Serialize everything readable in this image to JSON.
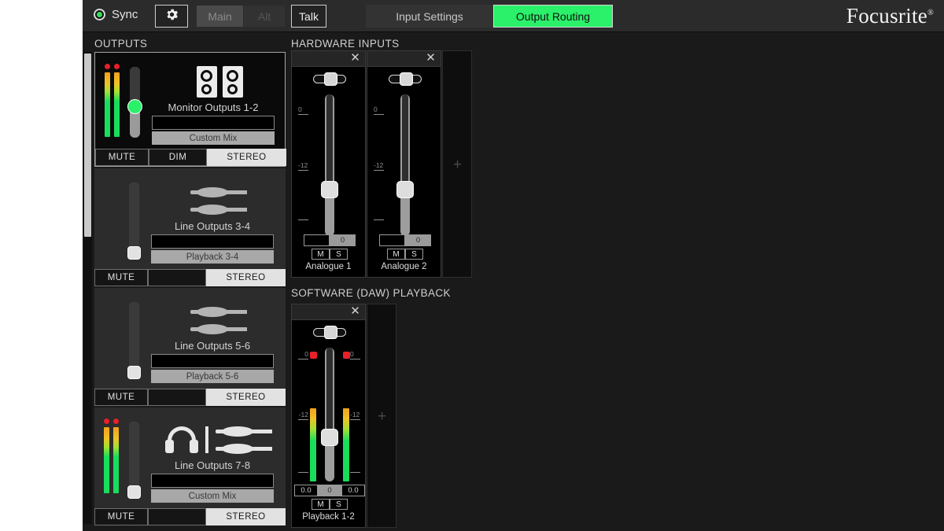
{
  "header": {
    "sync_label": "Sync",
    "gear_icon": "gear-icon",
    "main_label": "Main",
    "alt_label": "Alt",
    "talk_label": "Talk",
    "tab_input": "Input Settings",
    "tab_output": "Output Routing",
    "brand": "Focusrite",
    "brand_mark": "®",
    "active_tab": "Output Routing",
    "accent_color": "#2bf06a"
  },
  "sections": {
    "outputs": "OUTPUTS",
    "hardware_inputs": "HARDWARE INPUTS",
    "software_playback": "SOFTWARE (DAW) PLAYBACK"
  },
  "outputs": [
    {
      "name": "Monitor Outputs 1-2",
      "icon": "speakers-icon",
      "source_field": "",
      "source": "Custom Mix",
      "selected": true,
      "fader_pos": 0.45,
      "knob_style": "green",
      "meters": [
        {
          "level": 0.78,
          "clip": true
        },
        {
          "level": 0.78,
          "clip": true
        }
      ],
      "buttons": [
        "MUTE",
        "DIM",
        "STEREO"
      ],
      "active_button": "STEREO"
    },
    {
      "name": "Line Outputs 3-4",
      "icon": "trs-jacks-icon",
      "source_field": "",
      "source": "Playback 3-4",
      "selected": false,
      "fader_pos": 0.04,
      "knob_style": "plain",
      "meters": [],
      "buttons": [
        "MUTE",
        "",
        "STEREO"
      ],
      "active_button": "STEREO"
    },
    {
      "name": "Line Outputs 5-6",
      "icon": "trs-jacks-icon",
      "source_field": "",
      "source": "Playback 5-6",
      "selected": false,
      "fader_pos": 0.04,
      "knob_style": "plain",
      "meters": [],
      "buttons": [
        "MUTE",
        "",
        "STEREO"
      ],
      "active_button": "STEREO"
    },
    {
      "name": "Line Outputs 7-8",
      "icon": "headphones-jacks-icon",
      "source_field": "",
      "source": "Custom Mix",
      "selected": false,
      "fader_pos": 0.04,
      "knob_style": "plain",
      "meters": [
        {
          "level": 0.8,
          "clip": true
        },
        {
          "level": 0.8,
          "clip": true
        }
      ],
      "buttons": [
        "MUTE",
        "",
        "STEREO"
      ],
      "active_button": "STEREO"
    }
  ],
  "hardware_inputs": {
    "scale_top": "0",
    "scale_mid": "-12",
    "close_icon": "close-icon",
    "add_icon": "plus-icon",
    "channels": [
      {
        "name": "Analogue 1",
        "gain": "0",
        "pan": 0.5,
        "fader_pos": 0.33,
        "mute": "M",
        "solo": "S"
      },
      {
        "name": "Analogue 2",
        "gain": "0",
        "pan": 0.5,
        "fader_pos": 0.33,
        "mute": "M",
        "solo": "S"
      }
    ]
  },
  "software_playback": {
    "scale_top": "0",
    "scale_mid": "-12",
    "close_icon": "close-icon",
    "add_icon": "plus-icon",
    "channels": [
      {
        "name": "Playback 1-2",
        "value_left": "0.0",
        "gain": "0",
        "value_right": "0.0",
        "pan": 0.5,
        "fader_pos": 0.33,
        "mute": "M",
        "solo": "S",
        "meters": [
          {
            "level": 0.62,
            "clip": true
          },
          {
            "level": 0.62,
            "clip": true
          }
        ]
      }
    ]
  }
}
